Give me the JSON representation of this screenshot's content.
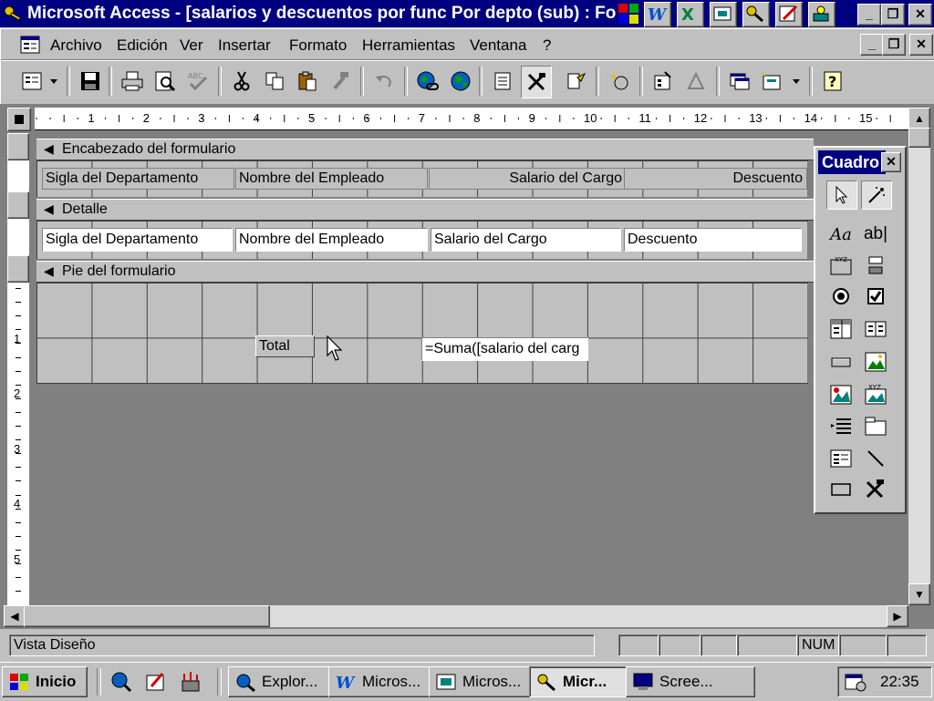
{
  "window": {
    "title": "Microsoft Access - [salarios y descuentos por func Por depto (sub) : Fo",
    "min_glyph": "_",
    "max_glyph": "❐",
    "close_glyph": "✕"
  },
  "menubar": {
    "items": [
      "Archivo",
      "Edición",
      "Ver",
      "Insertar",
      "Formato",
      "Herramientas",
      "Ventana",
      "?"
    ]
  },
  "ruler": {
    "h_numbers": [
      "1",
      "2",
      "3",
      "4",
      "5",
      "6",
      "7",
      "8",
      "9",
      "10",
      "11",
      "12",
      "13",
      "14",
      "15"
    ],
    "v_numbers": [
      "1",
      "2",
      "3",
      "4",
      "5"
    ]
  },
  "form": {
    "header_section": "Encabezado del formulario",
    "detail_section": "Detalle",
    "footer_section": "Pie del formulario",
    "header_labels": [
      "Sigla del Departamento",
      "Nombre del Empleado",
      "",
      "Salario del Cargo",
      "",
      "Descuento"
    ],
    "detail_fields": [
      "Sigla del Departamento",
      "Nombre del Empleado",
      "Salario del Cargo",
      "Descuento"
    ],
    "footer_label": "Total",
    "footer_field": "=Suma([salario del carg"
  },
  "toolbox": {
    "title": "Cuadro",
    "close_glyph": "✕",
    "tools": [
      "select-pointer",
      "control-wizards",
      "label",
      "text-box",
      "option-group",
      "toggle-button",
      "option-button",
      "check-box",
      "combo-box",
      "list-box",
      "command-button",
      "image",
      "unbound-object-frame",
      "bound-object-frame",
      "page-break",
      "tab-control",
      "subform",
      "line",
      "rectangle",
      "more-controls"
    ],
    "label_glyph": "Aa",
    "textbox_glyph": "ab|"
  },
  "statusbar": {
    "text": "Vista Diseño",
    "num": "NUM"
  },
  "taskbar": {
    "start": "Inicio",
    "tasks": [
      "Explor...",
      "Micros...",
      "Micros...",
      "Micr...",
      "Scree..."
    ],
    "clock": "22:35"
  },
  "colors": {
    "titlebar": "#000080",
    "face": "#c0c0c0",
    "workspace": "#808080"
  }
}
